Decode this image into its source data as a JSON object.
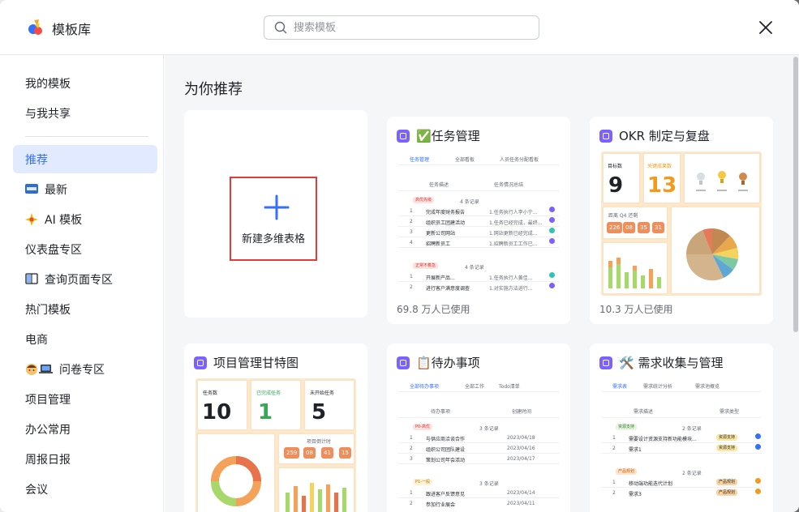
{
  "header": {
    "title": "模板库",
    "search_placeholder": "搜索模板"
  },
  "sidebar": {
    "items": [
      {
        "label": "我的模板"
      },
      {
        "label": "与我共享"
      },
      {
        "label": "推荐"
      },
      {
        "label": "最新"
      },
      {
        "label": "AI 模板"
      },
      {
        "label": "仪表盘专区"
      },
      {
        "label": "查询页面专区"
      },
      {
        "label": "热门模板"
      },
      {
        "label": "电商"
      },
      {
        "label": "问卷专区"
      },
      {
        "label": "项目管理"
      },
      {
        "label": "办公常用"
      },
      {
        "label": "周报日报"
      },
      {
        "label": "会议"
      }
    ],
    "active_index": 2
  },
  "main": {
    "section_title": "为你推荐",
    "new_card_label": "新建多维表格",
    "cards": [
      {
        "title": "✅任务管理",
        "usage": "69.8 万人已使用"
      },
      {
        "title": "OKR 制定与复盘",
        "usage": "10.3 万人已使用"
      },
      {
        "title": "项目管理甘特图",
        "usage": ""
      },
      {
        "title": "📋待办事项",
        "usage": ""
      },
      {
        "title": "🛠️ 需求收集与管理",
        "usage": ""
      }
    ]
  },
  "thumbs": {
    "task": {
      "tabs": [
        "任务管理",
        "全部看板",
        "人员任务分配看板"
      ],
      "cols": [
        "任务描述",
        "任务情况总结"
      ],
      "group1": "高优先级",
      "group2": "正常不着急",
      "group_count": "4 条记录",
      "rows1": [
        {
          "n": "1",
          "a": "完成年度财务报告",
          "b": "1.任务执行人李小宁..."
        },
        {
          "n": "2",
          "a": "组织员工团建活动",
          "b": "1.任务已经完成，最终..."
        },
        {
          "n": "3",
          "a": "更新公司网站",
          "b": "1.网站更新已经完成..."
        },
        {
          "n": "4",
          "a": "招聘新员工",
          "b": "1.招聘新员工工作已..."
        }
      ],
      "rows2": [
        {
          "n": "1",
          "a": "开展新产品...",
          "b": "1.任务执行人黄佳..."
        },
        {
          "n": "2",
          "a": "进行客户满意度调查",
          "b": "1.对实施方法进行..."
        }
      ]
    },
    "okr": {
      "k1_label": "目标数",
      "k1_value": "9",
      "k2_label": "关键成果数",
      "k2_value": "13",
      "q_label": "距离 Q4 还剩",
      "countdown": [
        "226",
        "08",
        "35",
        "31"
      ]
    },
    "gantt": {
      "k1_label": "任务数",
      "k1_value": "10",
      "k2_label": "已完成任务",
      "k2_value": "1",
      "k3_label": "未开始任务",
      "k3_value": "5",
      "countdown_label": "项目倒计时",
      "countdown": [
        "259",
        "08",
        "41",
        "15"
      ]
    },
    "todo": {
      "tabs": [
        "全部待办事项",
        "全部工作",
        "Todo清单"
      ],
      "cols": [
        "待办事项",
        "创建时间"
      ],
      "group1": "P0-高优",
      "group2": "P1-一般",
      "group_count": "3 条记录",
      "rows1": [
        {
          "n": "1",
          "a": "与供应商洽谈合作",
          "d": "2023/04/18"
        },
        {
          "n": "2",
          "a": "组织公司团队建设",
          "d": "2023/04/16"
        },
        {
          "n": "3",
          "a": "策划公司年会活动",
          "d": "2023/04/17"
        }
      ],
      "rows2": [
        {
          "n": "1",
          "a": "跟进客户反馈意见",
          "d": "2023/04/14"
        },
        {
          "n": "2",
          "a": "参加行业展会",
          "d": "2023/04/11"
        }
      ]
    },
    "req": {
      "tabs": [
        "需求表",
        "需求统计分析",
        "需求池概览"
      ],
      "cols": [
        "需求描述",
        "需求类型"
      ],
      "group1": "资源支持",
      "group2": "产品规划",
      "group_count": "2 条记录",
      "rows1": [
        {
          "n": "1",
          "a": "需要设计资源支持新功能模块...",
          "t": "资源支持"
        },
        {
          "n": "2",
          "a": "需求1",
          "t": "资源支持"
        }
      ],
      "rows2": [
        {
          "n": "1",
          "a": "移动端功能迭代计划",
          "t": "产品规划"
        },
        {
          "n": "2",
          "a": "需求3",
          "t": "产品规划"
        }
      ]
    }
  },
  "colors": {
    "accent": "#3370ff",
    "active_bg": "#e1eaff",
    "highlight_border": "#e03c3c",
    "badge": "#7b61ff",
    "okr_orange": "#f39a1e"
  }
}
